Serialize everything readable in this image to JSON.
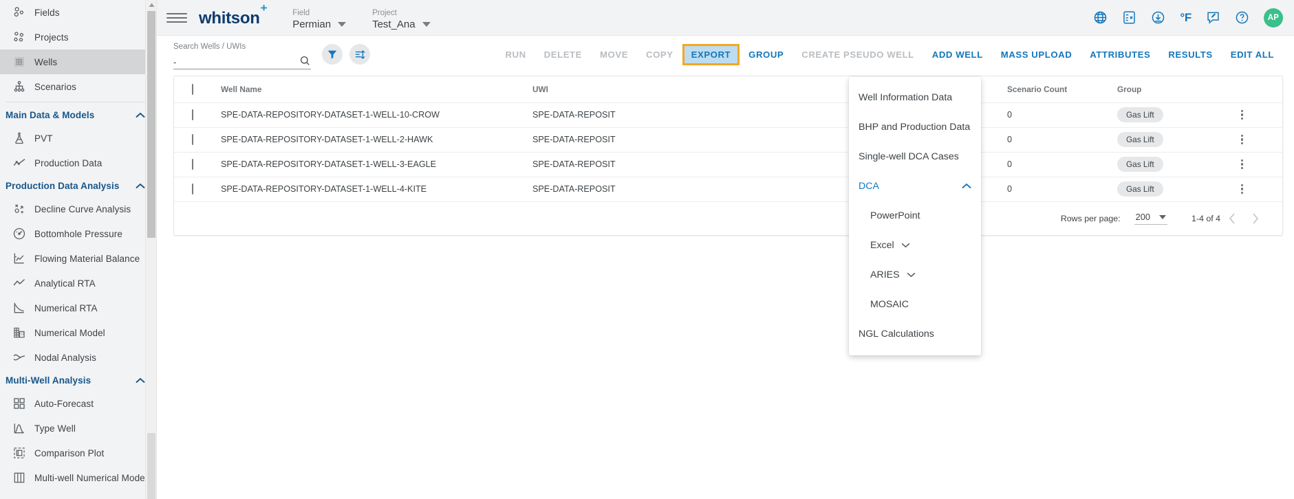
{
  "sidebar": {
    "top_items": [
      {
        "label": "Fields",
        "icon": "fields-icon",
        "active": false
      },
      {
        "label": "Projects",
        "icon": "projects-icon",
        "active": false
      },
      {
        "label": "Wells",
        "icon": "wells-icon",
        "active": true
      },
      {
        "label": "Scenarios",
        "icon": "scenarios-icon",
        "active": false
      }
    ],
    "groups": [
      {
        "title": "Main Data & Models",
        "items": [
          {
            "label": "PVT",
            "icon": "flask-icon"
          },
          {
            "label": "Production Data",
            "icon": "line-chart-icon"
          }
        ]
      },
      {
        "title": "Production Data Analysis",
        "items": [
          {
            "label": "Decline Curve Analysis",
            "icon": "decline-curve-icon"
          },
          {
            "label": "Bottomhole Pressure",
            "icon": "gauge-icon"
          },
          {
            "label": "Flowing Material Balance",
            "icon": "fmb-chart-icon"
          },
          {
            "label": "Analytical RTA",
            "icon": "zigzag-icon"
          },
          {
            "label": "Numerical RTA",
            "icon": "decay-chart-icon"
          },
          {
            "label": "Numerical Model",
            "icon": "grid-building-icon"
          },
          {
            "label": "Nodal Analysis",
            "icon": "nodal-curve-icon"
          }
        ]
      },
      {
        "title": "Multi-Well Analysis",
        "items": [
          {
            "label": "Auto-Forecast",
            "icon": "four-squares-icon"
          },
          {
            "label": "Type Well",
            "icon": "bell-curve-icon"
          },
          {
            "label": "Comparison Plot",
            "icon": "compare-icon"
          },
          {
            "label": "Multi-well Numerical Model",
            "icon": "columns-icon"
          }
        ]
      }
    ]
  },
  "header": {
    "brand": "whitson",
    "brand_sup": "+",
    "field": {
      "label": "Field",
      "value": "Permian"
    },
    "project": {
      "label": "Project",
      "value": "Test_Ana"
    },
    "icons": [
      {
        "name": "globe-icon"
      },
      {
        "name": "calculator-icon"
      },
      {
        "name": "download-icon"
      },
      {
        "name": "temperature-unit-toggle",
        "text": "°F"
      },
      {
        "name": "feedback-icon"
      },
      {
        "name": "help-icon"
      }
    ],
    "avatar_initials": "AP"
  },
  "search": {
    "label": "Search Wells / UWIs",
    "value": "-",
    "placeholder": "Search Wells / UWIs"
  },
  "toolbar": {
    "buttons": [
      {
        "label": "RUN",
        "state": "disabled"
      },
      {
        "label": "DELETE",
        "state": "disabled"
      },
      {
        "label": "MOVE",
        "state": "disabled"
      },
      {
        "label": "COPY",
        "state": "disabled"
      },
      {
        "label": "EXPORT",
        "state": "active"
      },
      {
        "label": "GROUP",
        "state": "enabled"
      },
      {
        "label": "CREATE PSEUDO WELL",
        "state": "disabled"
      },
      {
        "label": "ADD WELL",
        "state": "enabled"
      },
      {
        "label": "MASS UPLOAD",
        "state": "enabled"
      },
      {
        "label": "ATTRIBUTES",
        "state": "enabled"
      },
      {
        "label": "RESULTS",
        "state": "enabled"
      },
      {
        "label": "EDIT ALL",
        "state": "enabled"
      }
    ]
  },
  "export_menu": {
    "items": [
      {
        "label": "Well Information Data",
        "type": "item"
      },
      {
        "label": "BHP and Production Data",
        "type": "item"
      },
      {
        "label": "Single-well DCA Cases",
        "type": "item"
      },
      {
        "label": "DCA",
        "type": "expanded-parent",
        "chevron": "chevron-up-icon"
      },
      {
        "label": "PowerPoint",
        "type": "sub"
      },
      {
        "label": "Excel",
        "type": "sub-parent",
        "chevron": "chevron-down-icon"
      },
      {
        "label": "ARIES",
        "type": "sub-parent",
        "chevron": "chevron-down-icon"
      },
      {
        "label": "MOSAIC",
        "type": "sub"
      },
      {
        "label": "NGL Calculations",
        "type": "item"
      }
    ]
  },
  "table": {
    "columns": [
      "Well Name",
      "UWI",
      "Scenario Count",
      "Group"
    ],
    "rows": [
      {
        "well_name": "SPE-DATA-REPOSITORY-DATASET-1-WELL-10-CROW",
        "uwi": "SPE-DATA-REPOSIT",
        "scenario_count": "0",
        "group": "Gas Lift"
      },
      {
        "well_name": "SPE-DATA-REPOSITORY-DATASET-1-WELL-2-HAWK",
        "uwi": "SPE-DATA-REPOSIT",
        "scenario_count": "0",
        "group": "Gas Lift"
      },
      {
        "well_name": "SPE-DATA-REPOSITORY-DATASET-1-WELL-3-EAGLE",
        "uwi": "SPE-DATA-REPOSIT",
        "scenario_count": "0",
        "group": "Gas Lift"
      },
      {
        "well_name": "SPE-DATA-REPOSITORY-DATASET-1-WELL-4-KITE",
        "uwi": "SPE-DATA-REPOSIT",
        "scenario_count": "0",
        "group": "Gas Lift"
      }
    ]
  },
  "pagination": {
    "rows_per_page_label": "Rows per page:",
    "rows_per_page_value": "200",
    "range": "1-4 of 4"
  },
  "colors": {
    "brand_dark": "#0e3c6e",
    "accent_blue": "#1477bc",
    "highlight_orange": "#f5a623",
    "highlight_fill": "#bedcef",
    "avatar_green": "#3ac08a"
  }
}
